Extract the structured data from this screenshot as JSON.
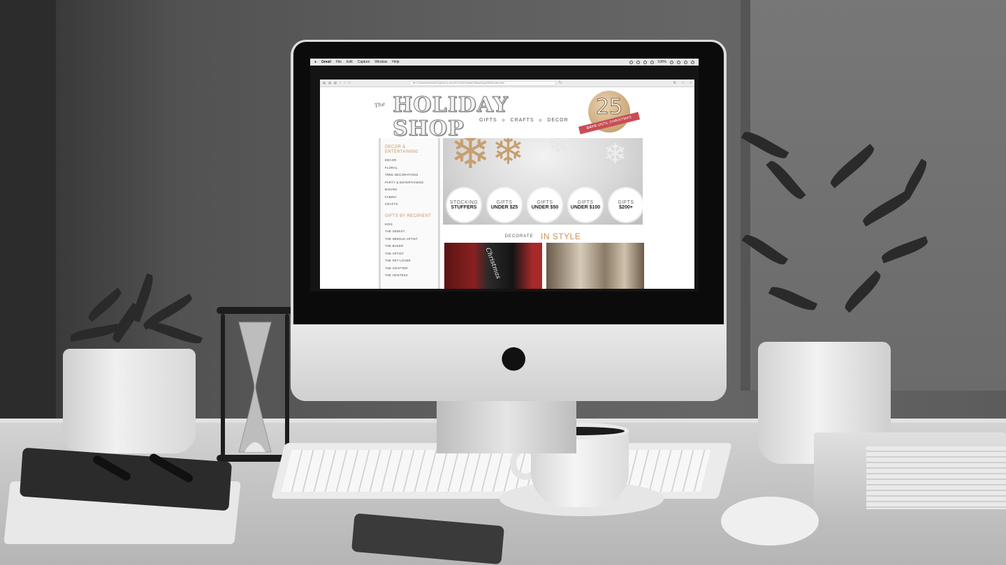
{
  "menubar": {
    "items": [
      "Gmail",
      "File",
      "Edit",
      "Capture",
      "Window",
      "Help"
    ],
    "battery": "100%"
  },
  "browser": {
    "url": "file:///Volumes/Works/Projects/Jo-Ann/HOLIDAY/eblast/HolidayShop/WEB/index.html"
  },
  "site": {
    "logo": {
      "the": "The",
      "title": "HOLIDAY SHOP",
      "sub": [
        "GIFTS",
        "CRAFTS",
        "DECOR"
      ]
    },
    "countdown": {
      "number": "25",
      "ribbon_bold": "DAYS",
      "ribbon_rest": "UNTIL CHRISTMAS"
    },
    "sidebar": {
      "groups": [
        {
          "heading": "DECOR & ENTERTAINING",
          "links": [
            "DECOR",
            "FLORAL",
            "TREE DECORATIONS",
            "PARTY & ENTERTAINING",
            "BAKING",
            "FABRIC",
            "CRAFTS"
          ]
        },
        {
          "heading": "GIFTS BY RECIPIENT",
          "links": [
            "KIDS",
            "THE SEWIST",
            "THE NEEDLE ARTIST",
            "THE BAKER",
            "THE ARTIST",
            "THE PET LOVER",
            "THE CRAFTER",
            "THE HOSTESS"
          ]
        }
      ]
    },
    "hero": {
      "circles": [
        {
          "top": "STOCKING",
          "bottom": "STUFFERS"
        },
        {
          "top": "GIFTS",
          "bottom": "UNDER $25"
        },
        {
          "top": "GIFTS",
          "bottom": "UNDER $50"
        },
        {
          "top": "GIFTS",
          "bottom": "UNDER $100"
        },
        {
          "top": "GIFTS",
          "bottom": "$200+"
        }
      ]
    },
    "decorate": {
      "small": "DECORATE",
      "big": "IN STYLE"
    },
    "photo_label": "Christmas"
  }
}
